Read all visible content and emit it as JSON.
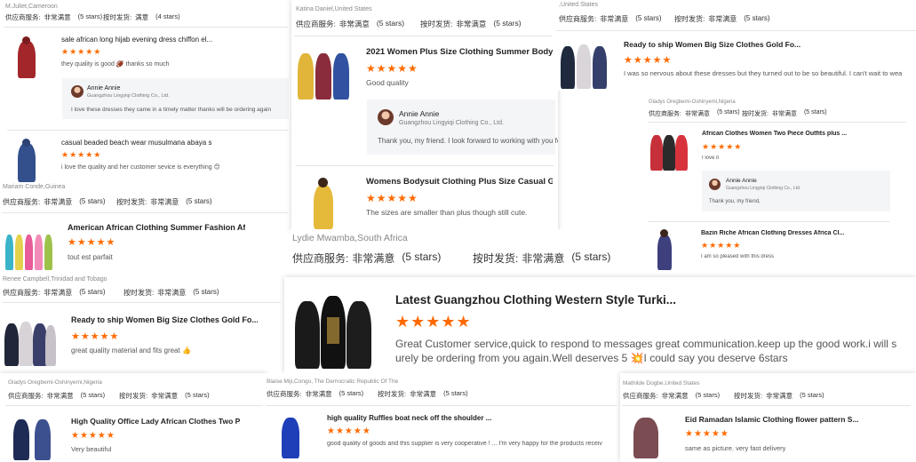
{
  "colors": {
    "star": "#ff6a00",
    "muted": "#888888",
    "text": "#333333"
  },
  "labels": {
    "supplier_service": "供应商服务:",
    "ship_on_time": "按时发货:",
    "satisfied": "非常满意",
    "five_stars": "(5 stars)",
    "four_stars": "(4 stars)",
    "satisfied_short": "满意"
  },
  "stars": "★★★★★",
  "cards": [
    {
      "id": "c1",
      "reviewer": "M.Juliet,Cameroon",
      "svc": "非常满意",
      "svc_stars": "(5 stars)",
      "ship": "满意",
      "ship_stars": "(4 stars)",
      "items": [
        {
          "title": "sale african long hijab evening dress chiffon el...",
          "review": "they quality is good 🏈 thanks so much",
          "reply": {
            "name": "Annie Annie",
            "company": "Guangzhou Lingyiqi Clothing Co., Ltd.",
            "text": "I love these dresses they came in a timely matter thanks will be ordering again"
          }
        },
        {
          "title": "casual beaded beach wear musulmana abaya s...",
          "review": "i love the quality and her customer sevice is everything 😊"
        }
      ]
    },
    {
      "id": "c2",
      "reviewer": "Katina Daniel,United States",
      "svc": "非常满意",
      "svc_stars": "(5 stars)",
      "ship": "非常满意",
      "ship_stars": "(5 stars)",
      "items": [
        {
          "title": "2021 Women Plus Size Clothing Summer Body...",
          "review": "Good quality",
          "reply": {
            "name": "Annie Annie",
            "company": "Guangzhou Lingyiqi Clothing Co., Ltd.",
            "text": "Thank you, my friend. I look forward to working with you for a long time."
          }
        },
        {
          "title": "Womens Bodysuit Clothing Plus Size Casual Gi...",
          "review": "The sizes are smaller than plus though still cute."
        }
      ]
    },
    {
      "id": "c3",
      "reviewer": ",United States",
      "svc": "非常满意",
      "svc_stars": "(5 stars)",
      "ship": "非常满意",
      "ship_stars": "(5 stars)",
      "items": [
        {
          "title": "Ready to ship Women Big Size Clothes Gold Fo...",
          "review": "I was so nervous about these dresses but they turned out to be so beautiful. I can't wait to wea"
        }
      ]
    },
    {
      "id": "c4",
      "reviewer": "Gladys Oregbemi-Oshinyemi,Nigeria",
      "svc": "非常满意",
      "svc_stars": "(5 stars)",
      "ship": "非常满意",
      "ship_stars": "(5 stars)",
      "items": [
        {
          "title": "African Clothes Women Two Piece Outfits plus ...",
          "review": "I love it",
          "reply": {
            "name": "Annie Annie",
            "company": "Guangzhou Lingyiqi Clothing Co., Ltd.",
            "text": "Thank you, my friend,"
          }
        },
        {
          "title": "Bazin Riche African Clothing Dresses Africa Cl...",
          "review": "I am so pleased with this dress"
        }
      ]
    },
    {
      "id": "c5",
      "reviewer": "Mariam Conde,Guinea",
      "svc": "非常满意",
      "svc_stars": "(5 stars)",
      "ship": "非常满意",
      "ship_stars": "(5 stars)",
      "items": [
        {
          "title": "American African Clothing Summer Fashion Af...",
          "review": "tout est parfait"
        }
      ]
    },
    {
      "id": "c6",
      "reviewer": "Lydie Mwamba,South Africa",
      "svc": "非常满意",
      "svc_stars": "(5 stars)",
      "ship": "非常满意",
      "ship_stars": "(5 stars)"
    },
    {
      "id": "c7",
      "reviewer": "Renee Campbell,Trinidad and Tobago",
      "svc": "非常满意",
      "svc_stars": "(5 stars)",
      "ship": "非常满意",
      "ship_stars": "(5 stars)",
      "items": [
        {
          "title": "Ready to ship Women Big Size Clothes Gold Fo...",
          "review": "great quality material and fits great 👍"
        }
      ]
    },
    {
      "id": "c8",
      "items": [
        {
          "title": "Latest Guangzhou Clothing Western Style Turki...",
          "review_line1": "Great Customer service,quick to respond to messages great communication.keep up the good work.i will s",
          "review_line2": "urely be ordering from you again.Well deserves 5 💥I could say you deserve 6stars"
        }
      ]
    },
    {
      "id": "c9",
      "reviewer": "Gladys Oregbemi-Oshinyemi,Nigeria",
      "svc": "非常满意",
      "svc_stars": "(5 stars)",
      "ship": "非常满意",
      "ship_stars": "(5 stars)",
      "items": [
        {
          "title": "High Quality Office Lady African Clothes Two P...",
          "review": "Very beautiful"
        }
      ]
    },
    {
      "id": "c10",
      "reviewer": "Blaise Miji,Congo, The Democratic Republic Of The",
      "svc": "非常满意",
      "svc_stars": "(5 stars)",
      "ship": "非常满意",
      "ship_stars": "(5 stars)",
      "items": [
        {
          "title": "high quality Ruffles boat neck off the shoulder ...",
          "review": "good quality of goods and this supplier is very cooperative ! ... I'm very happy for the products receiv"
        }
      ]
    },
    {
      "id": "c11",
      "reviewer": "Mathilde Dogbe,United States",
      "svc": "非常满意",
      "svc_stars": "(5 stars)",
      "ship": "非常满意",
      "ship_stars": "(5 stars)",
      "items": [
        {
          "title": "Eid Ramadan Islamic Clothing flower pattern S...",
          "review": "same as picture. very fast delivery"
        }
      ]
    }
  ]
}
